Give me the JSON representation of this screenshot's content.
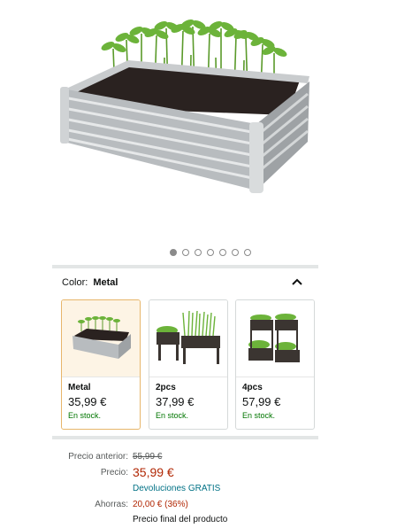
{
  "gallery": {
    "image_count": 7,
    "active_index": 0
  },
  "color_selector": {
    "label": "Color:",
    "value": "Metal"
  },
  "options": [
    {
      "name": "Metal",
      "price": "35,99 €",
      "stock": "En stock.",
      "selected": true
    },
    {
      "name": "2pcs",
      "price": "37,99 €",
      "stock": "En stock.",
      "selected": false
    },
    {
      "name": "4pcs",
      "price": "57,99 €",
      "stock": "En stock.",
      "selected": false
    }
  ],
  "pricing": {
    "previous_label": "Precio anterior:",
    "previous_value": "55,99 €",
    "price_label": "Precio:",
    "price_value": "35,99 €",
    "returns": "Devoluciones GRATIS",
    "savings_label": "Ahorras:",
    "savings_value": "20,00 € (36%)",
    "final_price_note": "Precio final del producto"
  },
  "colors": {
    "red": "#b12704",
    "link": "#007185",
    "stock": "#007600"
  }
}
